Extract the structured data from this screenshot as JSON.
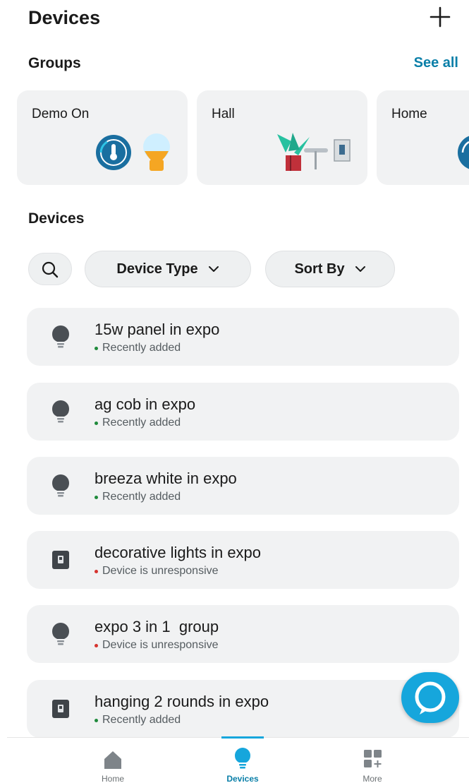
{
  "header": {
    "title": "Devices",
    "add_icon": "plus-icon"
  },
  "groups": {
    "title": "Groups",
    "see_all": "See all",
    "cards": [
      {
        "name": "Demo On",
        "icons": [
          "thermostat-icon",
          "bulb-icon"
        ]
      },
      {
        "name": "Hall",
        "icons": [
          "plant-icon",
          "switch-icon"
        ]
      },
      {
        "name": "Home",
        "icons": [
          "thermostat-icon"
        ]
      }
    ]
  },
  "devices": {
    "title": "Devices",
    "filters": {
      "search_icon": "search-icon",
      "device_type": "Device Type",
      "sort_by": "Sort By"
    },
    "items": [
      {
        "name": "15w panel in expo",
        "status": "Recently added",
        "status_color": "#1f8a3b",
        "icon": "bulb-icon"
      },
      {
        "name": "ag cob in expo",
        "status": "Recently added",
        "status_color": "#1f8a3b",
        "icon": "bulb-icon"
      },
      {
        "name": "breeza white in expo",
        "status": "Recently added",
        "status_color": "#1f8a3b",
        "icon": "bulb-icon"
      },
      {
        "name": "decorative lights in expo",
        "status": "Device is unresponsive",
        "status_color": "#d6332e",
        "icon": "plug-icon"
      },
      {
        "name": "expo 3 in 1  group",
        "status": "Device is unresponsive",
        "status_color": "#d6332e",
        "icon": "bulb-icon"
      },
      {
        "name": "hanging 2 rounds in expo",
        "status": "Recently added",
        "status_color": "#1f8a3b",
        "icon": "plug-icon"
      }
    ]
  },
  "fab": {
    "icon": "alexa-icon"
  },
  "nav": {
    "items": [
      {
        "label": "Home",
        "icon": "home-icon"
      },
      {
        "label": "Devices",
        "icon": "bulb-icon",
        "active": true
      },
      {
        "label": "More",
        "icon": "more-grid-icon"
      }
    ]
  },
  "colors": {
    "accent": "#16a6dc",
    "link": "#0a7fa8",
    "card": "#f1f2f3"
  }
}
